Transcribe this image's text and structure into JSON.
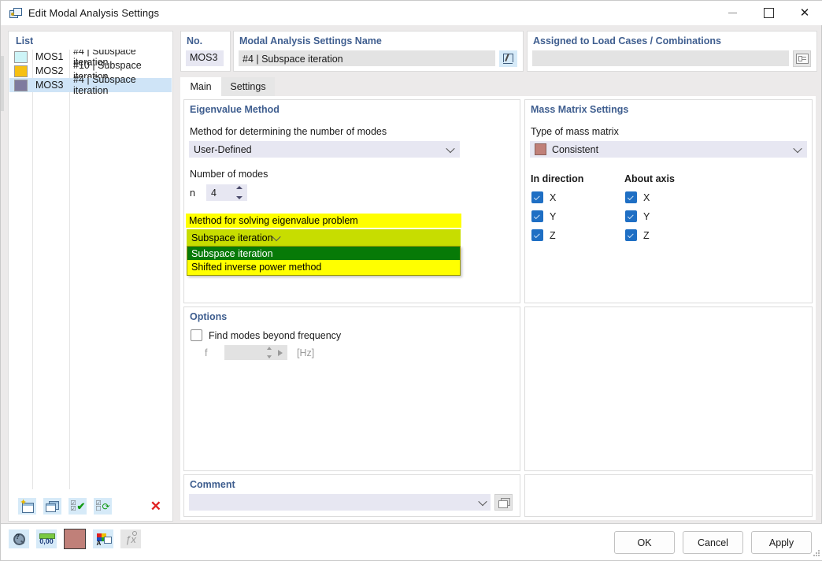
{
  "window": {
    "title": "Edit Modal Analysis Settings",
    "icon": "modal-analysis-icon",
    "minimize_label": "",
    "maximize_label": "",
    "close_label": "✕"
  },
  "list_panel": {
    "legend": "List",
    "rows": [
      {
        "code": "MOS1",
        "description": "#4 | Subspace iteration",
        "color": "#cdf4f7",
        "selected": false
      },
      {
        "code": "MOS2",
        "description": "#10 | Subspace iteration",
        "color": "#f6c013",
        "selected": false
      },
      {
        "code": "MOS3",
        "description": "#4 | Subspace iteration",
        "color": "#7e7a9e",
        "selected": true
      }
    ],
    "toolbar": [
      {
        "name": "new-item-button",
        "title": "New"
      },
      {
        "name": "copy-item-button",
        "title": "Copy"
      },
      {
        "name": "select-all-button",
        "title": "Select All"
      },
      {
        "name": "invert-selection-button",
        "title": "Invert Selection"
      },
      {
        "name": "delete-item-button",
        "title": "Delete",
        "glyph": "✕"
      }
    ]
  },
  "number_field": {
    "label": "No.",
    "value": "MOS3"
  },
  "name_field": {
    "label": "Modal Analysis Settings Name",
    "value": "#4 | Subspace iteration",
    "edit_button": "edit-name-button"
  },
  "assigned_field": {
    "label": "Assigned to Load Cases / Combinations",
    "value": "",
    "picker_button": "assigned-picker-button"
  },
  "tabs": [
    {
      "label": "Main",
      "active": true
    },
    {
      "label": "Settings",
      "active": false
    }
  ],
  "eigenvalue_method": {
    "legend": "Eigenvalue Method",
    "method_modes_label": "Method for determining the number of modes",
    "method_modes_value": "User-Defined",
    "number_of_modes_label": "Number of modes",
    "n_symbol": "n",
    "n_value": "4",
    "solving_label": "Method for solving eigenvalue problem",
    "solving_value": "Subspace iteration",
    "solving_options": [
      {
        "label": "Subspace iteration",
        "selected": true
      },
      {
        "label": "Shifted inverse power method",
        "selected": false
      }
    ],
    "highlight_color": "#ffff00",
    "combo_highlight_color": "#c7dd00",
    "option_selected_color": "#077a07"
  },
  "mass_matrix": {
    "legend": "Mass Matrix Settings",
    "type_label": "Type of mass matrix",
    "type_value": "Consistent",
    "type_swatch_color": "#c08079",
    "in_direction_header": "In direction",
    "about_axis_header": "About axis",
    "in_direction": [
      {
        "label": "X",
        "checked": true
      },
      {
        "label": "Y",
        "checked": true
      },
      {
        "label": "Z",
        "checked": true
      }
    ],
    "about_axis": [
      {
        "label": "X",
        "checked": true
      },
      {
        "label": "Y",
        "checked": true
      },
      {
        "label": "Z",
        "checked": true
      }
    ]
  },
  "options": {
    "legend": "Options",
    "find_modes_label": "Find modes beyond frequency",
    "find_modes_checked": false,
    "f_symbol": "f",
    "f_value": "",
    "f_unit": "[Hz]"
  },
  "comment": {
    "legend": "Comment",
    "value": "",
    "picker_button": "comment-picker-button"
  },
  "bottom_toolbar": [
    {
      "name": "info-search-button",
      "title": "Info"
    },
    {
      "name": "units-button",
      "title": "Units and Decimal Places"
    },
    {
      "name": "color-swatch-button",
      "title": "Color",
      "color": "#c08079"
    },
    {
      "name": "display-properties-button",
      "title": "Display Properties"
    },
    {
      "name": "formula-button",
      "title": "Formula",
      "disabled": true
    }
  ],
  "dialog_buttons": [
    {
      "label": "OK",
      "name": "ok-button"
    },
    {
      "label": "Cancel",
      "name": "cancel-button"
    },
    {
      "label": "Apply",
      "name": "apply-button"
    }
  ]
}
